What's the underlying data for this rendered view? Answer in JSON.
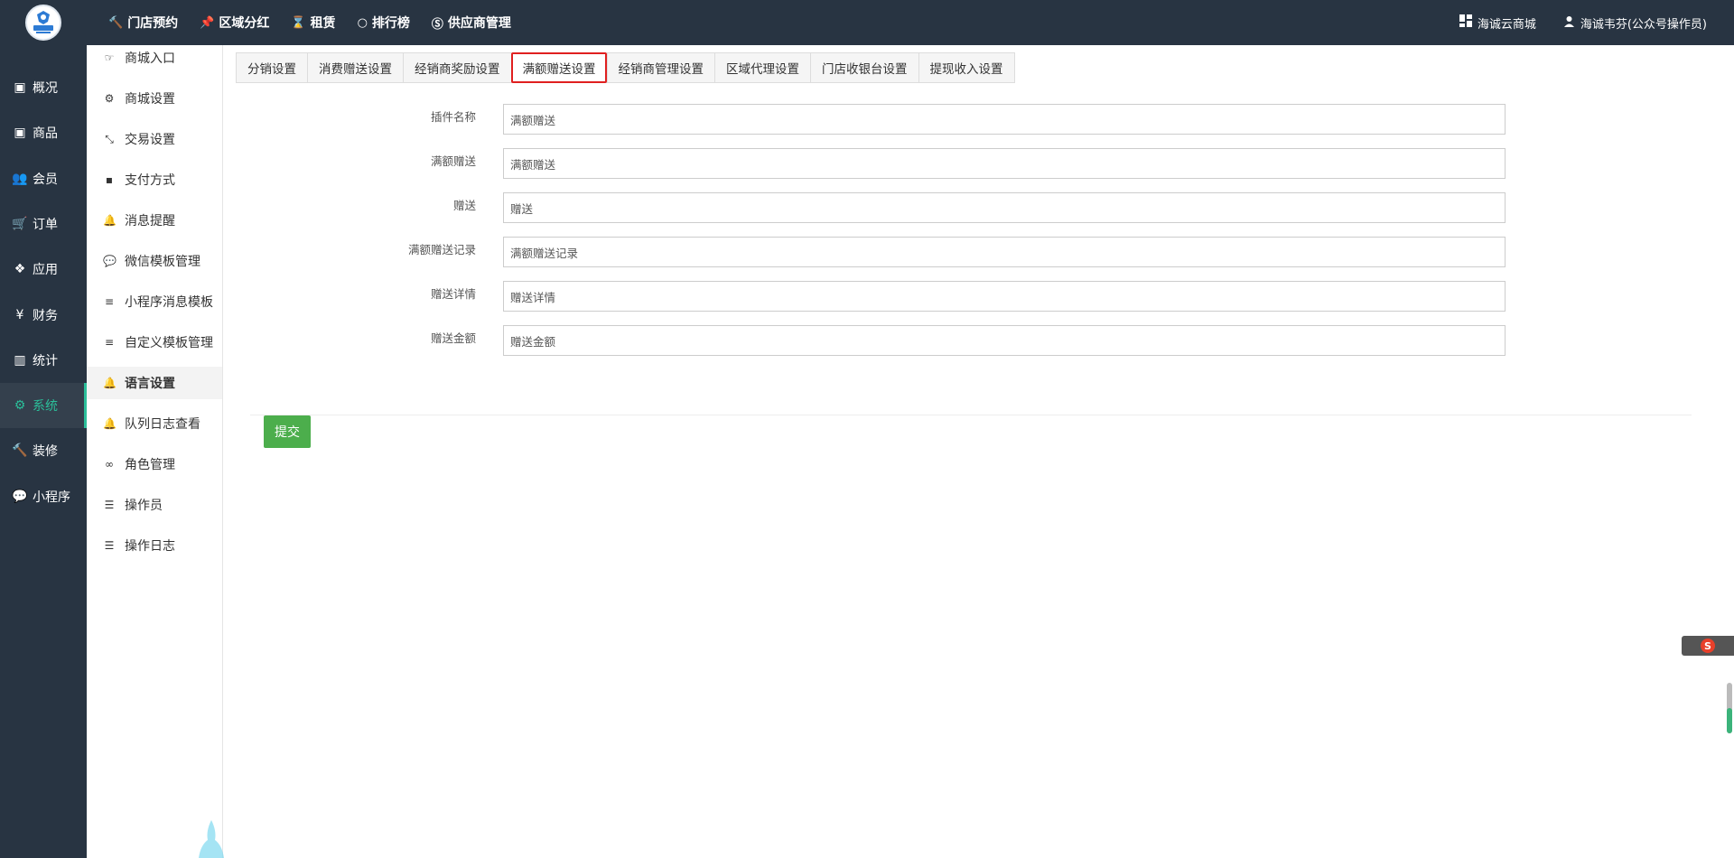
{
  "topnav": [
    {
      "label": "门店预约",
      "icon": "hammer-icon"
    },
    {
      "label": "区域分红",
      "icon": "pin-icon"
    },
    {
      "label": "租赁",
      "icon": "hourglass-icon"
    },
    {
      "label": "排行榜",
      "icon": "circle-icon"
    },
    {
      "label": "供应商管理",
      "icon": "skype-icon"
    }
  ],
  "topright": {
    "store": "海诚云商城",
    "user": "海诚韦芬(公众号操作员)"
  },
  "sidebar": [
    {
      "label": "概况",
      "icon": "box-icon"
    },
    {
      "label": "商品",
      "icon": "box-icon"
    },
    {
      "label": "会员",
      "icon": "users-icon"
    },
    {
      "label": "订单",
      "icon": "cart-icon"
    },
    {
      "label": "应用",
      "icon": "cubes-icon"
    },
    {
      "label": "财务",
      "icon": "yen-icon"
    },
    {
      "label": "统计",
      "icon": "bar-chart-icon"
    },
    {
      "label": "系统",
      "icon": "gears-icon"
    },
    {
      "label": "装修",
      "icon": "hammer-icon"
    },
    {
      "label": "小程序",
      "icon": "wechat-icon"
    }
  ],
  "sidebar_active": "系统",
  "subsidebar": [
    {
      "label": "商城入口",
      "icon": "hand-right-icon"
    },
    {
      "label": "商城设置",
      "icon": "gear-icon"
    },
    {
      "label": "交易设置",
      "icon": "compress-icon"
    },
    {
      "label": "支付方式",
      "icon": "facebook-square-icon"
    },
    {
      "label": "消息提醒",
      "icon": "bell-icon"
    },
    {
      "label": "微信模板管理",
      "icon": "wechat-icon"
    },
    {
      "label": "小程序消息模板",
      "icon": "list-icon"
    },
    {
      "label": "自定义模板管理",
      "icon": "list-icon"
    },
    {
      "label": "语言设置",
      "icon": "bell-icon"
    },
    {
      "label": "队列日志查看",
      "icon": "bell-icon"
    },
    {
      "label": "角色管理",
      "icon": "mask-icon"
    },
    {
      "label": "操作员",
      "icon": "list-ul-icon"
    },
    {
      "label": "操作日志",
      "icon": "list-ul-icon"
    }
  ],
  "subsidebar_active": "语言设置",
  "tabs": [
    "分销设置",
    "消费赠送设置",
    "经销商奖励设置",
    "满额赠送设置",
    "经销商管理设置",
    "区域代理设置",
    "门店收银台设置",
    "提现收入设置"
  ],
  "tabs_active": "满额赠送设置",
  "form": [
    {
      "label": "插件名称",
      "value": "满额赠送"
    },
    {
      "label": "满额赠送",
      "value": "满额赠送"
    },
    {
      "label": "赠送",
      "value": "赠送"
    },
    {
      "label": "满额赠送记录",
      "value": "满额赠送记录"
    },
    {
      "label": "赠送详情",
      "value": "赠送详情"
    },
    {
      "label": "赠送金额",
      "value": "赠送金额"
    }
  ],
  "submit_label": "提交",
  "ime_label": "S",
  "colors": {
    "sidebar_bg": "#283442",
    "accent": "#2bbf9a",
    "submit": "#4cae4c",
    "highlight": "#e02020"
  }
}
